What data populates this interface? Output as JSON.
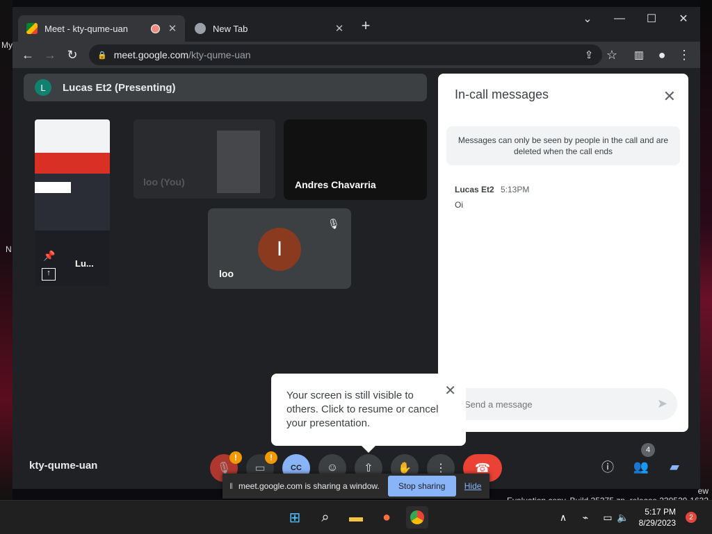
{
  "browser": {
    "tabs": [
      {
        "title": "Meet - kty-qume-uan",
        "active": true
      },
      {
        "title": "New Tab",
        "active": false
      }
    ],
    "new_tab_icon": "+",
    "address_host": "meet.google.com",
    "address_path": "/kty-qume-uan"
  },
  "meet": {
    "presenting_initial": "L",
    "presenting_label": "Lucas Et2 (Presenting)",
    "tiles": {
      "self_name": "loo (You)",
      "andres_name": "Andres Chavarria",
      "loo_name": "loo",
      "loo_initial": "I"
    },
    "phone_overlay_label": "Lu...",
    "meeting_code": "kty-qume-uan",
    "people_count": "4"
  },
  "chat": {
    "title": "In-call messages",
    "notice": "Messages can only be seen by people in the call and are deleted when the call ends",
    "messages": [
      {
        "sender": "Lucas Et2",
        "time": "5:13PM",
        "text": "Oi"
      }
    ],
    "input_placeholder": "Send a message"
  },
  "tooltip": {
    "text": "Your screen is still visible to others. Click to resume or cancel your presentation."
  },
  "share_bar": {
    "text": "meet.google.com is sharing a window.",
    "stop_label": "Stop sharing",
    "hide_label": "Hide"
  },
  "watermark": {
    "line1": "ew",
    "line2": "Evaluation copy. Build 25375.zn_release.230520-1632"
  },
  "desktop": {
    "label_my": "My",
    "label_n": "N"
  },
  "taskbar": {
    "time": "5:17 PM",
    "date": "8/29/2023",
    "notification_count": "2"
  },
  "colors": {
    "accent_blue": "#8ab4f8",
    "hangup_red": "#ea4335",
    "warning_orange": "#f29900"
  }
}
